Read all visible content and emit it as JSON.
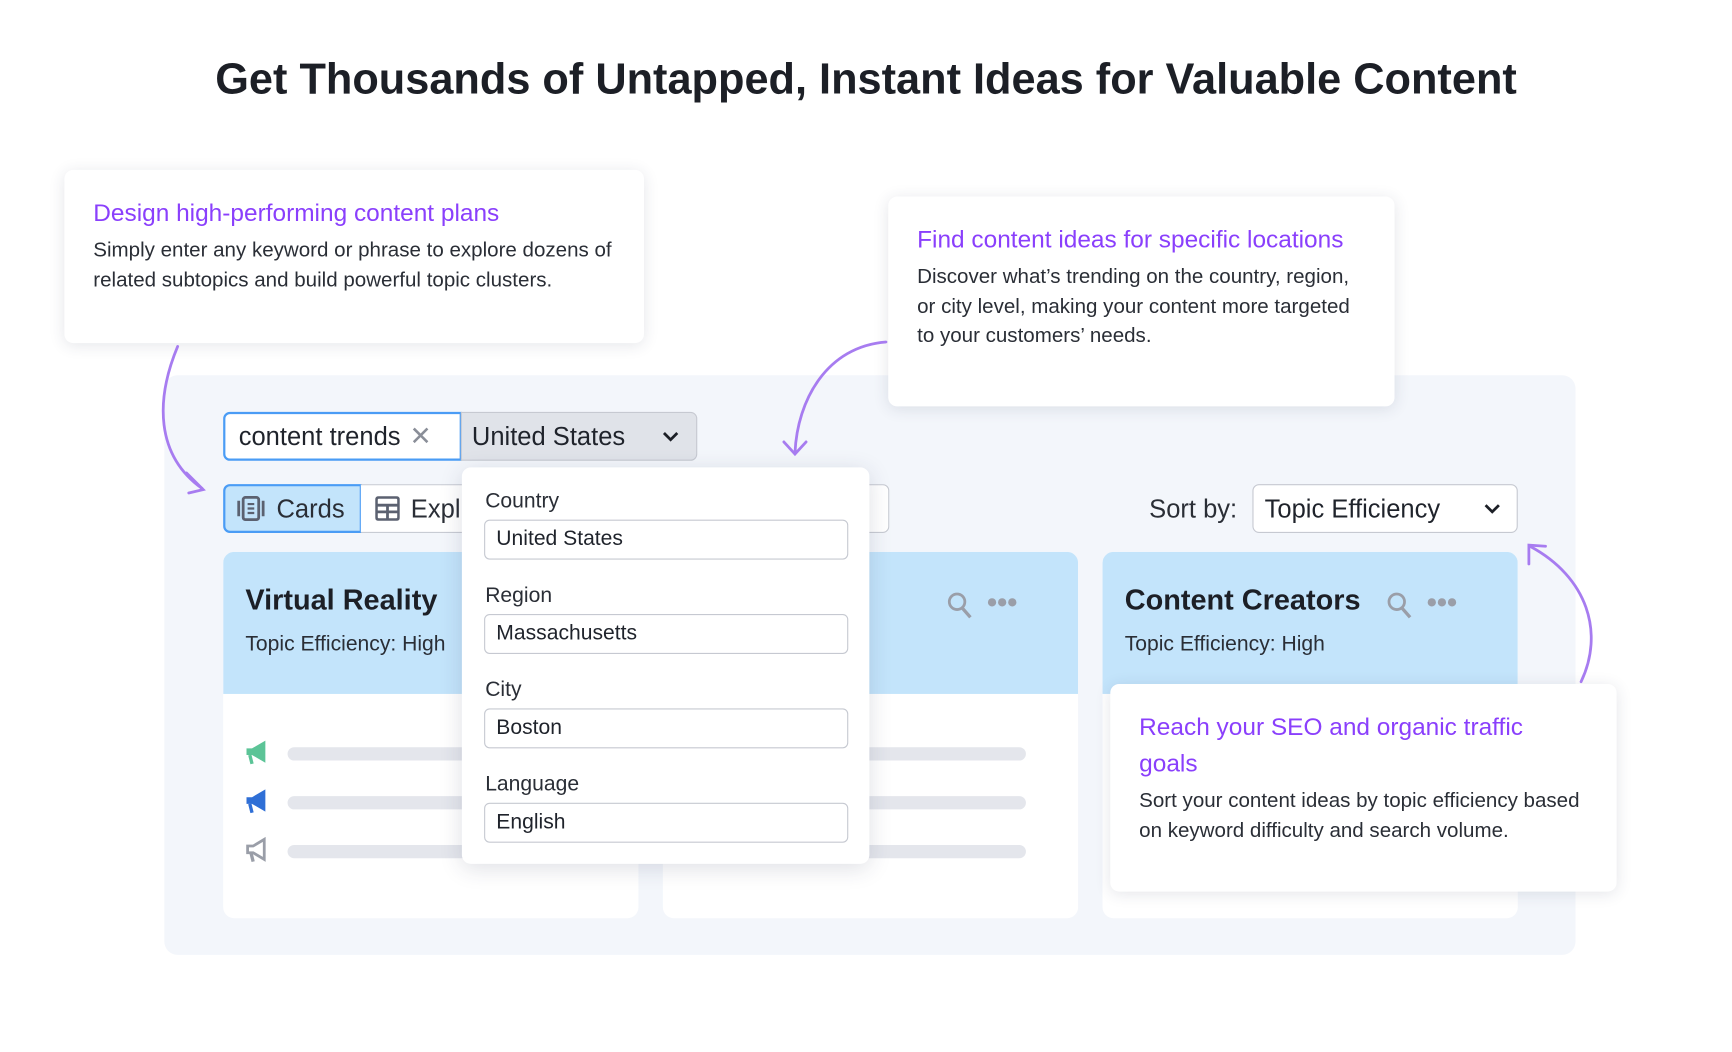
{
  "headline": "Get Thousands of Untapped, Instant Ideas for Valuable Content",
  "callouts": [
    {
      "title": "Design high-performing content plans",
      "body": "Simply enter any keyword or phrase to explore dozens of related subtopics and build powerful topic clusters."
    },
    {
      "title": "Find content ideas for specific locations",
      "body": "Discover what’s trending on the country, region, or city level, making your content more targeted to your customers’ needs."
    },
    {
      "title": "Reach your SEO and organic traffic goals",
      "body": "Sort your content ideas by topic efficiency based on keyword difficulty and search volume."
    }
  ],
  "search": {
    "value": "content trends",
    "country": "United States"
  },
  "tabs": [
    {
      "label": "Cards",
      "active": true
    },
    {
      "label": "Expl"
    }
  ],
  "sort": {
    "label": "Sort by:",
    "value": "Topic Efficiency"
  },
  "cards": [
    {
      "title": "Virtual Reality",
      "efficiency": "Topic Efficiency: High"
    },
    {
      "title": "",
      "efficiency": ""
    },
    {
      "title": "Content Creators",
      "efficiency": "Topic Efficiency: High"
    }
  ],
  "location_dropdown": {
    "fields": [
      {
        "label": "Country",
        "value": "United States"
      },
      {
        "label": "Region",
        "value": "Massachusetts"
      },
      {
        "label": "City",
        "value": "Boston"
      },
      {
        "label": "Language",
        "value": "English"
      }
    ]
  },
  "colors": {
    "accent": "#8a3ffc",
    "card_header": "#c3e4fb",
    "panel": "#f3f6fb",
    "active_tab": "#c3e4fb",
    "megaphone_green": "#5cc497",
    "megaphone_blue": "#2f6fd6",
    "megaphone_grey": "#9a9ea8",
    "arrow": "#a77cf0"
  }
}
